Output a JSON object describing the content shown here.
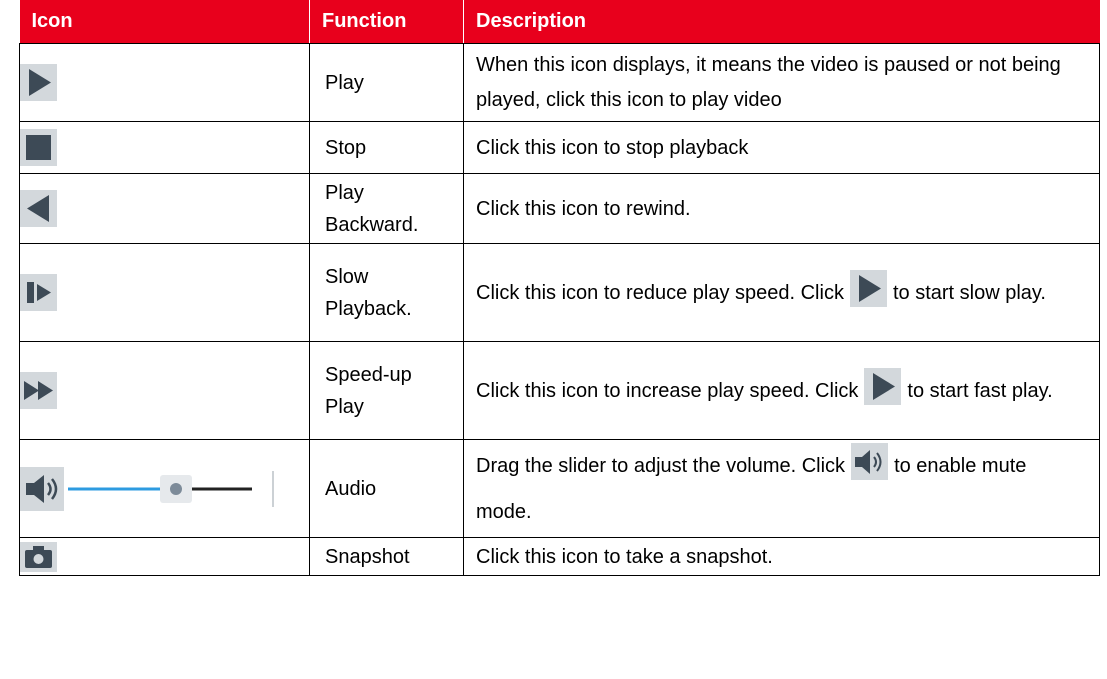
{
  "table": {
    "headers": [
      "Icon",
      "Function",
      "Description"
    ],
    "rows": [
      {
        "icon": "play-icon",
        "function": "Play",
        "description": "When this icon displays, it means the video is paused or not being played, click this icon to play video"
      },
      {
        "icon": "stop-icon",
        "function": "Stop",
        "description": "Click this icon to stop playback"
      },
      {
        "icon": "play-backward-icon",
        "function": "Play Backward.",
        "description": "Click this icon to rewind."
      },
      {
        "icon": "slow-playback-icon",
        "function": "Slow Playback.",
        "description_before": "Click this icon to reduce play speed. Click",
        "description_icon": "play-icon",
        "description_after": "to start slow play."
      },
      {
        "icon": "speed-up-icon",
        "function": "Speed-up Play",
        "description_before": "Click this icon to increase play speed. Click",
        "description_icon": "play-icon",
        "description_after": "to start fast play."
      },
      {
        "icon": "audio-volume-slider-icon",
        "function": "Audio",
        "description_before": "Drag the slider to adjust the volume. Click",
        "description_icon": "speaker-icon",
        "description_after": "to enable mute mode."
      },
      {
        "icon": "camera-icon",
        "function": "Snapshot",
        "description": "Click this icon to take a snapshot."
      }
    ]
  },
  "colors": {
    "header_bg": "#e8001c",
    "icon_bg": "#d3d8dc",
    "icon_fg": "#3d4a56",
    "slider_blue": "#2d9be0"
  }
}
